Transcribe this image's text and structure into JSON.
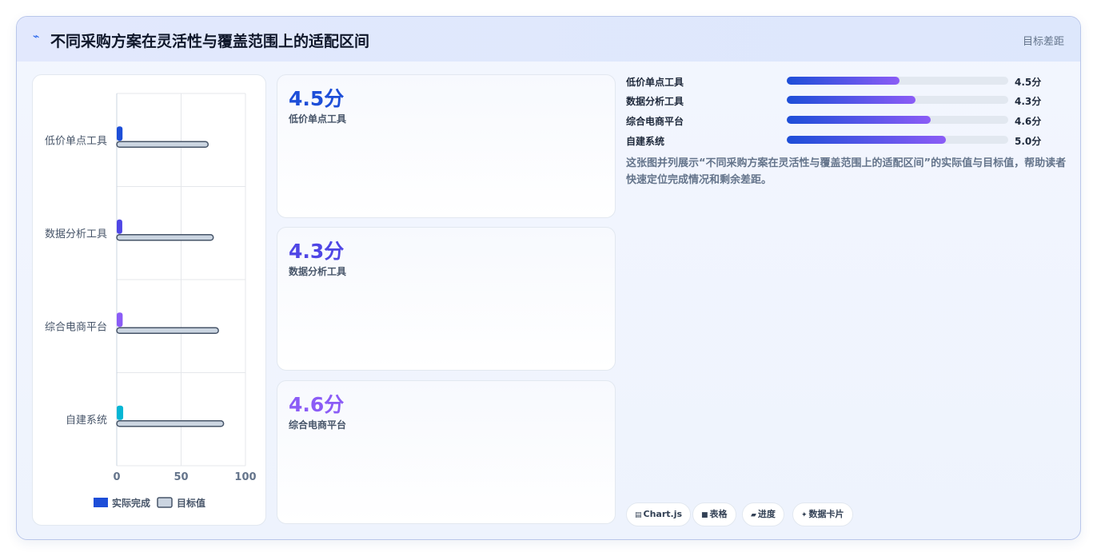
{
  "header": {
    "icon": "chart-line-icon",
    "title": "不同采购方案在灵活性与覆盖范围上的适配区间",
    "right_label": "目标差距"
  },
  "colors": {
    "actual": [
      "#1d4ed8",
      "#4f46e5",
      "#8b5cf6",
      "#06b6d4"
    ],
    "target": "#cbd5e1",
    "target_stroke": "#475569"
  },
  "chart_data": {
    "type": "bar",
    "orientation": "horizontal",
    "categories": [
      "低价单点工具",
      "数据分析工具",
      "综合电商平台",
      "自建系统"
    ],
    "series": [
      {
        "name": "实际完成",
        "values": [
          4.5,
          4.3,
          4.6,
          5.0
        ]
      },
      {
        "name": "目标值",
        "values": [
          71,
          75,
          79,
          83
        ]
      }
    ],
    "xlim": [
      0,
      100
    ],
    "xticks": [
      "0",
      "50",
      "100"
    ],
    "grid": true,
    "legend": "bottom"
  },
  "kpis": [
    {
      "value": "4.5分",
      "label": "低价单点工具",
      "color": "#1d4ed8"
    },
    {
      "value": "4.3分",
      "label": "数据分析工具",
      "color": "#4f46e5"
    },
    {
      "value": "4.6分",
      "label": "综合电商平台",
      "color": "#8b5cf6"
    }
  ],
  "progress": [
    {
      "label": "低价单点工具",
      "value": "4.5分",
      "fraction": 0.51
    },
    {
      "label": "数据分析工具",
      "value": "4.3分",
      "fraction": 0.58
    },
    {
      "label": "综合电商平台",
      "value": "4.6分",
      "fraction": 0.65
    },
    {
      "label": "自建系统",
      "value": "5.0分",
      "fraction": 0.72
    }
  ],
  "description": "这张图并列展示“不同采购方案在灵活性与覆盖范围上的适配区间”的实际值与目标值，帮助读者快速定位完成情况和剩余差距。",
  "chips": [
    {
      "icon": "chart-icon",
      "glyph": "▤",
      "label": "Chart.js"
    },
    {
      "icon": "table-icon",
      "glyph": "■",
      "label": "表格"
    },
    {
      "icon": "progress-icon",
      "glyph": "▰",
      "label": "进度"
    },
    {
      "icon": "card-icon",
      "glyph": "✦",
      "label": "数据卡片"
    }
  ]
}
